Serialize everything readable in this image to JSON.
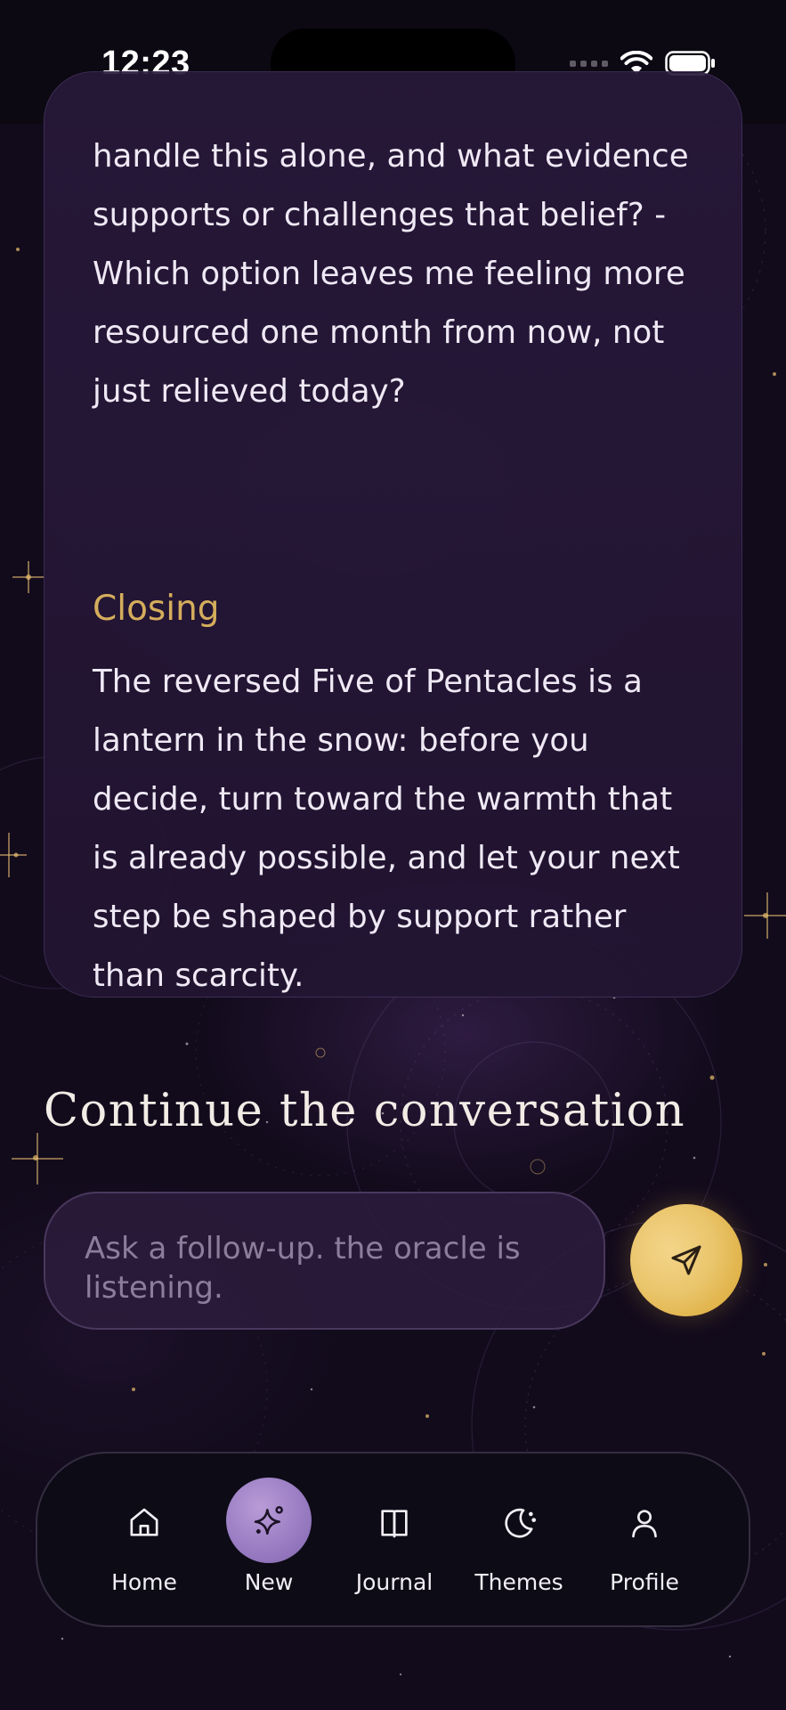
{
  "status_bar": {
    "time": "12:23"
  },
  "reading": {
    "text_top": "handle this alone, and what evidence supports or challenges that belief? - Which option leaves me feeling more resourced one month from now, not just relieved today?",
    "closing_heading": "Closing",
    "closing_text": "The reversed Five of Pentacles is a lantern in the snow: before you decide, turn toward the warmth that is already possible, and let your next step be shaped by support rather than scarcity."
  },
  "conversation": {
    "title": "Continue the conversation",
    "input_placeholder": "Ask a follow-up. the oracle is listening.",
    "send_icon": "paper-plane-icon"
  },
  "nav": {
    "items": [
      {
        "label": "Home",
        "icon": "home-icon"
      },
      {
        "label": "New",
        "icon": "sparkles-icon",
        "active": true
      },
      {
        "label": "Journal",
        "icon": "book-icon"
      },
      {
        "label": "Themes",
        "icon": "moon-icon"
      },
      {
        "label": "Profile",
        "icon": "user-icon"
      }
    ]
  },
  "colors": {
    "background": "#120b1c",
    "card": "#261837",
    "heading_accent": "#d5ad5c",
    "send_button": "#eac56c",
    "nav_active": "#9a7dc3"
  }
}
